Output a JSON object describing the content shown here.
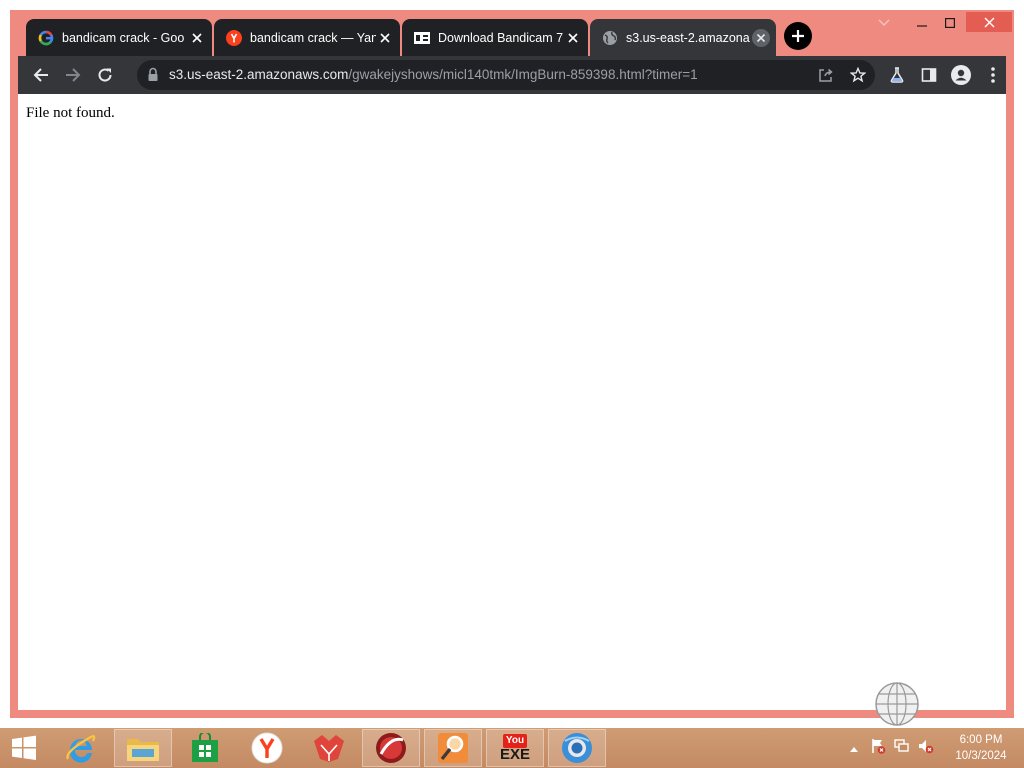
{
  "browser": {
    "tabs": [
      {
        "title": "bandicam crack - Goo",
        "favicon": "google-icon",
        "active": false
      },
      {
        "title": "bandicam crack — Yan",
        "favicon": "yandex-icon",
        "active": false
      },
      {
        "title": "Download Bandicam 7",
        "favicon": "site-logo-icon",
        "active": false
      },
      {
        "title": "s3.us-east-2.amazona",
        "favicon": "globe-icon",
        "active": true
      }
    ],
    "address": {
      "host": "s3.us-east-2.amazonaws.com",
      "path": "/gwakejyshows/micl140tmk/ImgBurn-859398.html?timer=1"
    }
  },
  "page": {
    "message": "File not found."
  },
  "taskbar": {
    "apps": [
      "start",
      "internet-explorer",
      "file-explorer",
      "store",
      "yandex",
      "red-fox",
      "red-orb",
      "magnifier-app",
      "youtube-exe",
      "chrome"
    ],
    "youtube_label_top": "You",
    "youtube_label_bottom": "EXE",
    "clock_time": "6:00 PM",
    "clock_date": "10/3/2024"
  },
  "colors": {
    "frame": "#ee8a80",
    "tab_active": "#35363a",
    "tab_inactive": "#202124",
    "taskbar": "#c8916a"
  }
}
